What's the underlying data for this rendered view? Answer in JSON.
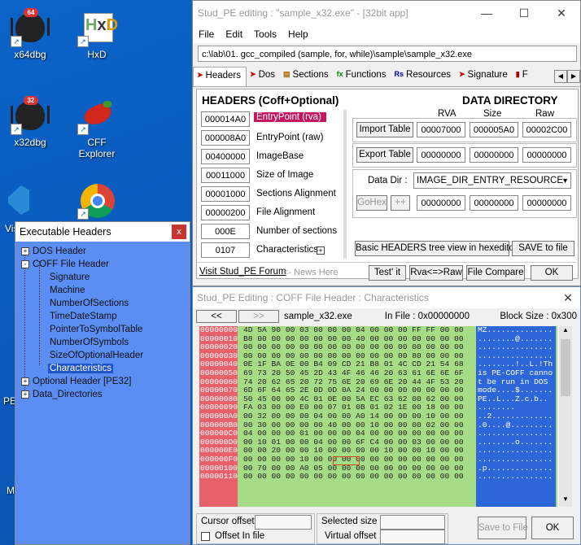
{
  "desktop": {
    "icons": [
      {
        "label": "x64dbg",
        "badge": "64"
      },
      {
        "label": "HxD"
      },
      {
        "label": "x32dbg",
        "badge": "32"
      },
      {
        "label": "CFF Explorer"
      }
    ],
    "partial_labels": [
      "Vis",
      "PE",
      "M"
    ]
  },
  "main": {
    "title": "Stud_PE editing : \"sample_x32.exe\" - [32bit app]",
    "menu": [
      "File",
      "Edit",
      "Tools",
      "Help"
    ],
    "path": "c:\\lab\\01. gcc_compiled (sample, for, while)\\sample\\sample_x32.exe",
    "tabs": [
      "Headers",
      "Dos",
      "Sections",
      "Functions",
      "Resources",
      "Signature",
      "F"
    ],
    "headers_title": "HEADERS (Coff+Optional)",
    "dir_title": "DATA  DIRECTORY",
    "fields": [
      {
        "value": "000014A0",
        "label": "EntryPoint (rva)"
      },
      {
        "value": "000008A0",
        "label": "EntryPoint (raw)"
      },
      {
        "value": "00400000",
        "label": "ImageBase"
      },
      {
        "value": "00011000",
        "label": "Size of Image"
      },
      {
        "value": "00001000",
        "label": "Sections Alignment"
      },
      {
        "value": "00000200",
        "label": "File Alignment"
      },
      {
        "value": "000E",
        "label": "Number of sections"
      },
      {
        "value": "0107",
        "label": "Characteristics"
      }
    ],
    "col_headers": [
      "RVA",
      "Size",
      "Raw"
    ],
    "import_row": {
      "label": "Import Table",
      "rva": "00007000",
      "size": "000005A0",
      "raw": "00002C00"
    },
    "export_row": {
      "label": "Export Table",
      "rva": "00000000",
      "size": "00000000",
      "raw": "00000000"
    },
    "datadir": {
      "label": "Data Dir :",
      "value": "IMAGE_DIR_ENTRY_RESOURCE",
      "gohex": "GoHex",
      "plus": "++",
      "rva": "00000000",
      "size": "00000000",
      "raw": "00000000"
    },
    "basic_btn": "Basic HEADERS tree view in hexeditor",
    "save_btn": "SAVE to file",
    "forum_link": "Visit Stud_PE Forum",
    "news": "<- News Here",
    "testit": "Test' it",
    "rvaraw": "Rva<=>Raw",
    "filecompare": "File Compare",
    "ok": "OK"
  },
  "hex": {
    "title": "Stud_PE Editing : COFF File Header : Characteristics",
    "nav_prev": "<<",
    "nav_next": ">>",
    "file": "sample_x32.exe",
    "infile": "In File : 0x00000000",
    "block": "Block Size : 0x300",
    "offsets": [
      "00000000",
      "00000010",
      "00000020",
      "00000030",
      "00000040",
      "00000050",
      "00000060",
      "00000070",
      "00000080",
      "00000090",
      "000000A0",
      "000000B0",
      "000000C0",
      "000000D0",
      "000000E0",
      "000000F0",
      "00000100",
      "00000110"
    ],
    "bytes": [
      "4D 5A 90 00 03 00 00 00 04 00 00 00 FF FF 00 00",
      "B8 00 00 00 00 00 00 00 40 00 00 00 00 00 00 00",
      "00 00 00 00 00 00 00 00 00 00 00 00 00 00 00 00",
      "00 00 00 00 00 00 00 00 00 00 00 00 80 00 00 00",
      "0E 1F BA 0E 00 B4 09 CD 21 B8 01 4C CD 21 54 68",
      "69 73 20 50 45 2D 43 4F 46 46 20 63 61 6E 6E 6F",
      "74 20 62 65 20 72 75 6E 20 69 6E 20 44 4F 53 20",
      "6D 6F 64 65 2E 0D 0D 0A 24 00 00 00 00 00 00 00",
      "50 45 00 00 4C 01 0E 00 5A EC 63 62 00 62 00 00",
      "FA 03 00 00 E0 00 07 01 0B 01 02 1E 00 18 00 00",
      "00 32 00 00 00 04 00 00 A0 14 00 00 00 10 00 00",
      "00 30 00 00 00 00 40 00 00 10 00 00 00 02 00 00",
      "04 00 00 00 01 00 00 00 04 00 00 00 00 00 00 00",
      "00 10 01 00 00 04 00 00 6F C4 00 00 03 00 00 00",
      "00 00 20 00 00 10 00 00 00 00 10 00 00 10 00 00",
      "00 00 00 00 10 00 00 00 00 00 00 00 00 00 00 00",
      "00 70 00 00 A0 05 00 00 00 00 00 00 00 00 00 00",
      "00 00 00 00 00 00 00 00 00 00 00 00 00 00 00 00"
    ],
    "ascii": [
      "MZ..............",
      "........@.......",
      "................",
      "................",
      "........!..L.!Th",
      "is PE-COFF canno",
      "t be run in DOS ",
      "mode....$.......",
      "PE..L...Z.c.b..",
      "........",
      "..2.............",
      ".0....@.........",
      "................",
      "........o.......",
      "................",
      "................",
      ".p..............",
      "................"
    ],
    "highlight": "07 01",
    "cursor_label": "Cursor offset :",
    "offset_label": "Offset In file",
    "selected_label": "Selected size :",
    "virtual_label": "Virtual offset :",
    "save_btn": "Save to File",
    "ok": "OK"
  },
  "tree": {
    "title": "Executable Headers",
    "close": "x",
    "nodes": [
      {
        "label": "DOS Header",
        "toggle": "+"
      },
      {
        "label": "COFF File Header",
        "toggle": "-"
      },
      {
        "label": "Signature"
      },
      {
        "label": "Machine"
      },
      {
        "label": "NumberOfSections"
      },
      {
        "label": "TimeDateStamp"
      },
      {
        "label": "PointerToSymbolTable"
      },
      {
        "label": "NumberOfSymbols"
      },
      {
        "label": "SizeOfOptionalHeader"
      },
      {
        "label": "Characteristics"
      },
      {
        "label": "Optional Header [PE32]",
        "toggle": "+"
      },
      {
        "label": "Data_Directories",
        "toggle": "+"
      }
    ]
  },
  "colors": {
    "desktop": "#0a5fc4",
    "tree_bg": "#5b8df3",
    "hex_green": "#a6dc86",
    "hex_red": "#e8606a",
    "hex_ascii": "#2c66d8",
    "entry_highlight": "#c4175f"
  }
}
